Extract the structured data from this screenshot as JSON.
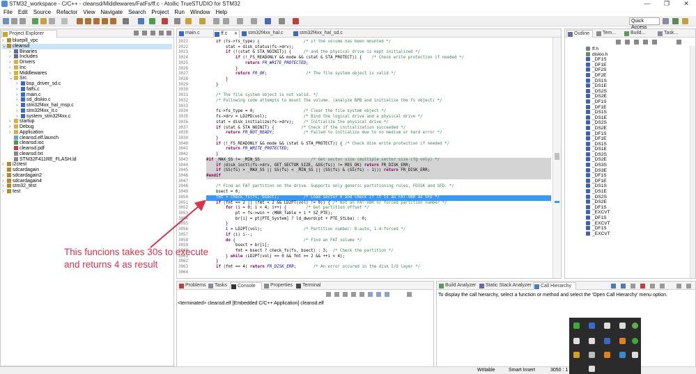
{
  "window": {
    "title": "STM32_workspace - C/C++ - cleansd/Middlewares/FatFs/ff.c - Atollic TrueSTUDIO for STM32",
    "min": "—",
    "max": "❐",
    "close": "✕"
  },
  "menu": [
    "File",
    "Edit",
    "Source",
    "Refactor",
    "View",
    "Navigate",
    "Search",
    "Project",
    "Run",
    "Window",
    "Help"
  ],
  "toolbar": {
    "quick_access": "Quick Access"
  },
  "explorer": {
    "tab": "Project Explorer",
    "items": [
      {
        "label": "bluepill_vpc",
        "depth": 0,
        "arrow": "›",
        "color": "#b08a2e"
      },
      {
        "label": "cleansd",
        "depth": 0,
        "arrow": "⌄",
        "color": "#b08a2e",
        "selected": true
      },
      {
        "label": "Binaries",
        "depth": 1,
        "arrow": "›",
        "color": "#6a6a9a"
      },
      {
        "label": "Includes",
        "depth": 1,
        "arrow": "›",
        "color": "#6a6a9a"
      },
      {
        "label": "Drivers",
        "depth": 1,
        "arrow": "›",
        "color": "#d8b040"
      },
      {
        "label": "Inc",
        "depth": 1,
        "arrow": "›",
        "color": "#d8b040"
      },
      {
        "label": "Middlewares",
        "depth": 1,
        "arrow": "›",
        "color": "#d8b040"
      },
      {
        "label": "Src",
        "depth": 1,
        "arrow": "⌄",
        "color": "#d8b040"
      },
      {
        "label": "bsp_driver_sd.c",
        "depth": 2,
        "arrow": "›",
        "color": "#3a6ac0"
      },
      {
        "label": "fatfs.c",
        "depth": 2,
        "arrow": "›",
        "color": "#3a6ac0"
      },
      {
        "label": "main.c",
        "depth": 2,
        "arrow": "›",
        "color": "#3a6ac0"
      },
      {
        "label": "sd_diskio.c",
        "depth": 2,
        "arrow": "›",
        "color": "#3a6ac0"
      },
      {
        "label": "stm32f4xx_hal_msp.c",
        "depth": 2,
        "arrow": "›",
        "color": "#3a6ac0"
      },
      {
        "label": "stm32f4xx_it.c",
        "depth": 2,
        "arrow": "›",
        "color": "#3a6ac0"
      },
      {
        "label": "system_stm32f4xx.c",
        "depth": 2,
        "arrow": "›",
        "color": "#3a6ac0"
      },
      {
        "label": "startup",
        "depth": 1,
        "arrow": "›",
        "color": "#d8b040"
      },
      {
        "label": "Debug",
        "depth": 1,
        "arrow": "›",
        "color": "#d8b040"
      },
      {
        "label": "Application",
        "depth": 1,
        "arrow": "›",
        "color": "#d8b040"
      },
      {
        "label": "cleansd.elf.launch",
        "depth": 1,
        "arrow": "",
        "color": "#6aa0d0"
      },
      {
        "label": "cleansd.ioc",
        "depth": 1,
        "arrow": "",
        "color": "#40a040"
      },
      {
        "label": "cleansd.pdf",
        "depth": 1,
        "arrow": "",
        "color": "#c04040"
      },
      {
        "label": "cleansd.txt",
        "depth": 1,
        "arrow": "",
        "color": "#888888"
      },
      {
        "label": "STM32F411RE_FLASH.ld",
        "depth": 1,
        "arrow": "",
        "color": "#888888"
      },
      {
        "label": "i2ctest",
        "depth": 0,
        "arrow": "›",
        "color": "#b08a2e"
      },
      {
        "label": "sdcardagain",
        "depth": 0,
        "arrow": "",
        "color": "#b08a2e"
      },
      {
        "label": "sdcardagain2",
        "depth": 0,
        "arrow": "›",
        "color": "#b08a2e"
      },
      {
        "label": "sdcardagain4",
        "depth": 0,
        "arrow": "›",
        "color": "#b08a2e"
      },
      {
        "label": "stm32_test",
        "depth": 0,
        "arrow": "›",
        "color": "#b08a2e"
      },
      {
        "label": "test",
        "depth": 0,
        "arrow": "›",
        "color": "#b08a2e"
      }
    ]
  },
  "editor": {
    "tabs": [
      {
        "label": "main.c",
        "active": false
      },
      {
        "label": "ff.c",
        "active": true,
        "close": "✕"
      },
      {
        "label": "stm32f4xx_hal.c",
        "active": false
      },
      {
        "label": "stm32f4xx_hal_sd.c",
        "active": false
      }
    ],
    "lines": [
      {
        "n": "3021",
        "html": "    <span class='c-kw'>if</span> (fs-&gt;fs_type) {                  <span class='c-cm'>/* If the volume has been mounted */</span>"
      },
      {
        "n": "3022",
        "html": "        stat = disk_status(fs-&gt;drv);"
      },
      {
        "n": "3023",
        "html": "        <span class='c-kw'>if</span> (!(stat &amp; STA_NOINIT)) {     <span class='c-cm'>/* and the physical drive is kept initialized */</span>"
      },
      {
        "n": "3024",
        "html": "            <span class='c-kw'>if</span> (!_FS_READONLY &amp;&amp; mode &amp;&amp; (stat &amp; STA_PROTECT)) {    <span class='c-cm'>/* Check write protection if needed */</span>"
      },
      {
        "n": "3025",
        "html": "                <span class='c-kw'>return</span> <span class='c-it'>FR_WRITE_PROTECTED</span>;"
      },
      {
        "n": "3026",
        "html": "            }"
      },
      {
        "n": "3027",
        "html": "            <span class='c-kw'>return</span> <span class='c-it'>FR_OK</span>;                <span class='c-cm'>/* The file system object is valid */</span>"
      },
      {
        "n": "3028",
        "html": "        }"
      },
      {
        "n": "3029",
        "html": "    }"
      },
      {
        "n": "3030",
        "html": ""
      },
      {
        "n": "3031",
        "html": "    <span class='c-cm'>/* The file system object is not valid. */</span>"
      },
      {
        "n": "3032",
        "html": "    <span class='c-cm'>/* Following code attempts to mount the volume. (analyze BPB and initialize the fs object) */</span>"
      },
      {
        "n": "3033",
        "html": ""
      },
      {
        "n": "3034",
        "html": "    fs-&gt;fs_type = 0;                    <span class='c-cm'>/* Clear the file system object */</span>"
      },
      {
        "n": "3035",
        "html": "    fs-&gt;drv = LD2PD(vol);               <span class='c-cm'>/* Bind the logical drive and a physical drive */</span>"
      },
      {
        "n": "3036",
        "html": "    stat = disk_initialize(fs-&gt;drv);    <span class='c-cm'>/* Initialize the physical drive */</span>"
      },
      {
        "n": "3037",
        "html": "    <span class='c-kw'>if</span> (stat &amp; STA_NOINIT) {           <span class='c-cm'>/* Check if the initialization succeeded */</span>"
      },
      {
        "n": "3038",
        "html": "        <span class='c-kw'>return</span> <span class='c-it'>FR_NOT_READY</span>;            <span class='c-cm'>/* Failed to initialize due to no medium or hard error */</span>"
      },
      {
        "n": "3039",
        "html": "    }"
      },
      {
        "n": "3040",
        "html": "    <span class='c-kw'>if</span> (!_FS_READONLY &amp;&amp; mode &amp;&amp; (stat &amp; STA_PROTECT)) { <span class='c-cm'>/* Check disk write protection if needed */</span>"
      },
      {
        "n": "3041",
        "html": "        <span class='c-kw'>return</span> <span class='c-it'>FR_WRITE_PROTECTED</span>;"
      },
      {
        "n": "3042",
        "html": "    }"
      },
      {
        "n": "3043",
        "cls": "hlgray",
        "html": "<span class='c-kw'>#if</span> _MAX_SS != _MIN_SS                     <span class='c-cm'>/* Get sector size (multiple sector size cfg only) */</span>"
      },
      {
        "n": "3044",
        "cls": "hlgray",
        "html": "    <span class='c-kw'>if</span> (disk_ioctl(fs-&gt;drv, GET_SECTOR_SIZE, &amp;SS(fs)) != RES_OK) <span class='c-kw'>return</span> FR_DISK_ERR;"
      },
      {
        "n": "3045",
        "cls": "hlgray",
        "html": "    <span class='c-kw'>if</span> (SS(fs) &gt; _MAX_SS || SS(fs) &lt; _MIN_SS || (SS(fs) &amp; (SS(fs) - 1))) <span class='c-kw'>return</span> FR_DISK_ERR;"
      },
      {
        "n": "3046",
        "cls": "hlgray",
        "html": "<span class='c-kw'>#endif</span>"
      },
      {
        "n": "3047",
        "html": ""
      },
      {
        "n": "3048",
        "html": "    <span class='c-cm'>/* Find an FAT partition on the drive. Supports only generic partitioning rules, FDISK and SFD. */</span>"
      },
      {
        "n": "3049",
        "html": "    bsect = 0;"
      },
      {
        "n": "3050",
        "cls": "hlsel",
        "html": "    fmt = check_fs(fs, bsect);          /* Load sector 0 and check if it is an FAT-VBR as SFD */"
      },
      {
        "n": "3051",
        "html": "    <span class='c-kw'>if</span> (fmt == 2 || (fmt &lt; 2 &amp;&amp; LD2PT(vol) != 0)) { <span class='c-cm'>/* Not an FAT-VBR or forced partition number */</span>"
      },
      {
        "n": "3052",
        "html": "        <span class='c-kw'>for</span> (i = 0; i &lt; 4; i++) {        <span class='c-cm'>/* Get partition offset */</span>"
      },
      {
        "n": "3053",
        "html": "            pt = fs-&gt;win + (MBR_Table + i * SZ_PTE);"
      },
      {
        "n": "3054",
        "html": "            br[i] = pt[PTE_System] ? ld_dword(pt + PTE_StLba) : 0;"
      },
      {
        "n": "3055",
        "html": "        }"
      },
      {
        "n": "3056",
        "html": "        i = LD2PT(vol);                 <span class='c-cm'>/* Partition number: 0:auto, 1-4:forced */</span>"
      },
      {
        "n": "3057",
        "html": "        <span class='c-kw'>if</span> (i) i--;"
      },
      {
        "n": "3058",
        "html": "        <span class='c-kw'>do</span> {                            <span class='c-cm'>/* Find an FAT volume */</span>"
      },
      {
        "n": "3059",
        "html": "            bsect = br[i];"
      },
      {
        "n": "3060",
        "html": "            fmt = bsect ? check_fs(fs, bsect) : 3;  <span class='c-cm'>/* Check the partition */</span>"
      },
      {
        "n": "3061",
        "html": "        } <span class='c-kw'>while</span> (LD2PT(vol) == 0 &amp;&amp; fmt &gt;= 2 &amp;&amp; ++i &lt; 4);"
      },
      {
        "n": "3062",
        "html": "    }"
      },
      {
        "n": "3063",
        "html": "    <span class='c-kw'>if</span> (fmt == 4) <span class='c-kw'>return</span> <span class='c-it'>FR_DISK_ERR</span>;       <span class='c-cm'>/* An error occured in the disk I/O layer */</span>"
      },
      {
        "n": "3064",
        "html": ""
      }
    ]
  },
  "outline": {
    "tabs": [
      "Outline",
      "Tem...",
      "Build...",
      "Task..."
    ],
    "items": [
      "ff.h",
      "diskio.h",
      "_DF1S",
      "_DF1E",
      "_DF2S",
      "_DF2E",
      "_DS1S",
      "_DS1E",
      "_DS2S",
      "_DS2E",
      "_DF1S",
      "_DF1E",
      "_DS1S",
      "_DS1E",
      "_DS2S",
      "_DS2E",
      "_DF1S",
      "_DF1E",
      "_DS1S",
      "_DS1E",
      "_DS2S",
      "_DS2E",
      "_DS3S",
      "_DS3E",
      "_DF1S",
      "_DF1E",
      "_DS1S",
      "_DS1E",
      "_DS2S",
      "_DS2E",
      "_DF1S",
      "_EXCVT",
      "_DF1S",
      "_EXCVT",
      "_DF1S",
      "_EXCVT"
    ]
  },
  "console": {
    "tabs": [
      "Problems",
      "Tasks",
      "Console",
      "Properties",
      "Terminal"
    ],
    "text": "<terminated> cleansd.elf [Embedded C/C++ Application] cleansd.elf"
  },
  "hierarchy": {
    "tabs": [
      "Build Analyzer",
      "Static Stack Analyzer",
      "Call Hierarchy"
    ],
    "text": "To display the call hierarchy, select a function or method and select the 'Open Call Hierarchy' menu option."
  },
  "status": {
    "writable": "Writable",
    "insert": "Smart Insert",
    "pos": "3050 : 1"
  },
  "annotation": {
    "line1": "This funcions takes 30s to execute",
    "line2": "and returns 4 as result",
    "color": "#e0304a"
  }
}
